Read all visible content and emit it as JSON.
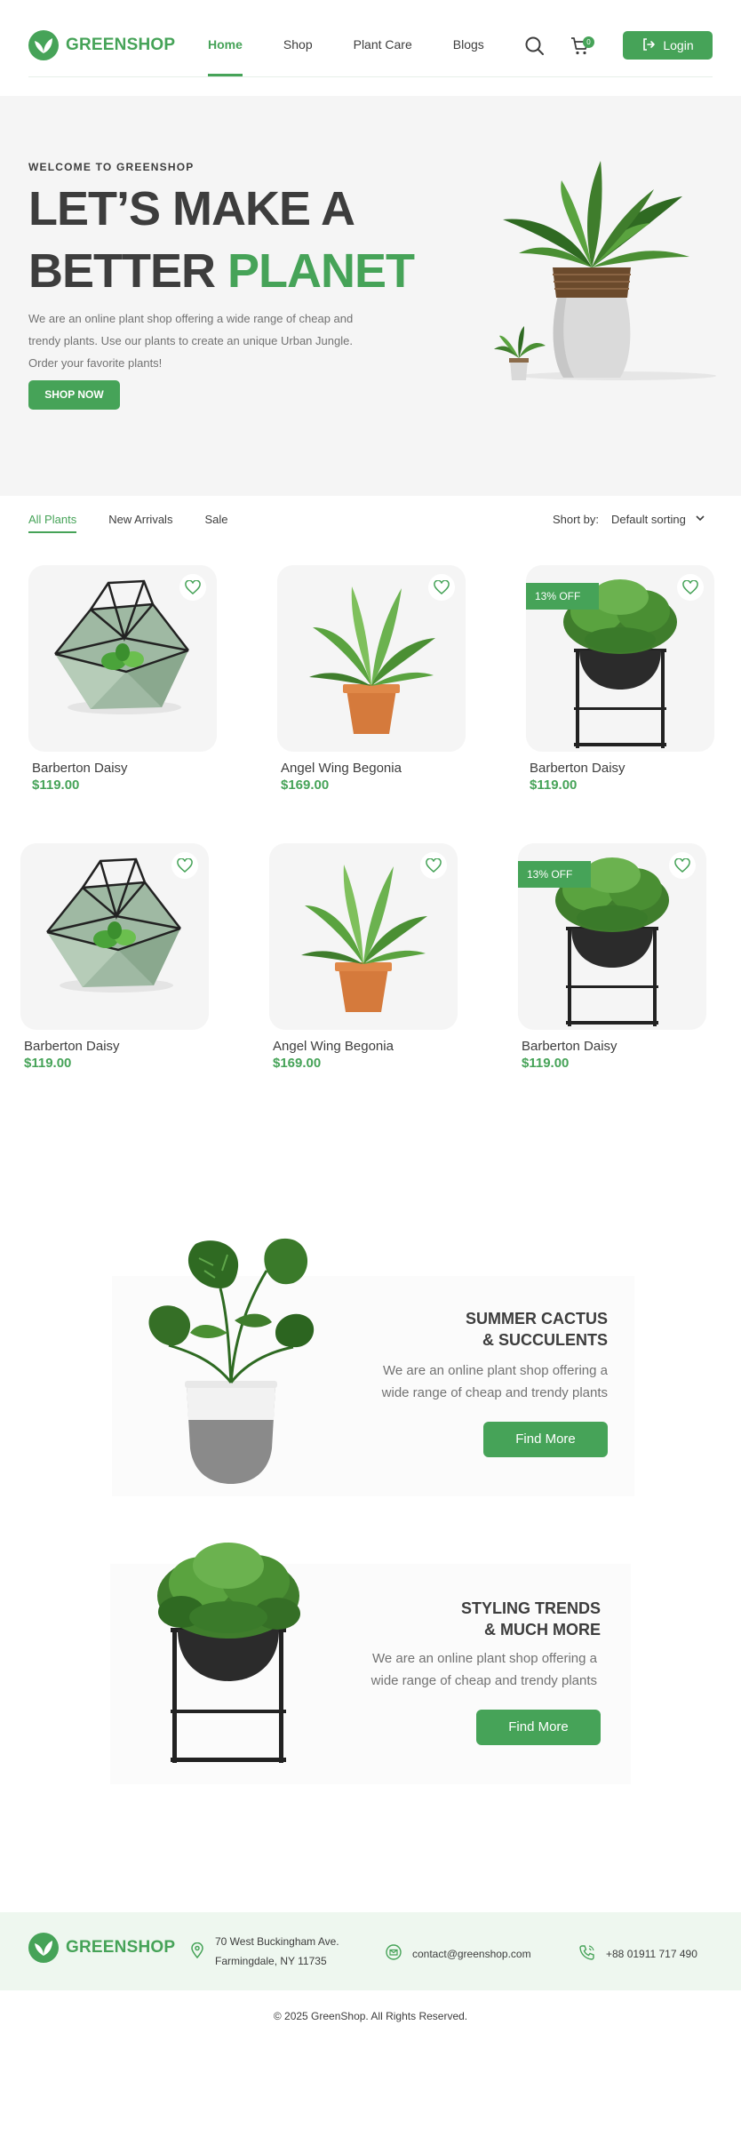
{
  "brand": {
    "name": "GREENSHOP",
    "accent": "#46a358",
    "text": "#3d3d3d"
  },
  "header": {
    "nav": [
      {
        "label": "Home",
        "active": true
      },
      {
        "label": "Shop",
        "active": false
      },
      {
        "label": "Plant Care",
        "active": false
      },
      {
        "label": "Blogs",
        "active": false
      }
    ],
    "cart_count": "0",
    "login_label": "Login",
    "icons": [
      "search-icon",
      "cart-icon",
      "logout-icon"
    ]
  },
  "hero": {
    "welcome": "WELCOME TO GREENSHOP",
    "title_line1": "LET’S MAKE A",
    "title_line2_prefix": "BETTER ",
    "title_line2_accent": "PLANET",
    "description": "We are an online plant shop offering a wide range of cheap and trendy plants. Use our plants to create an unique Urban Jungle. Order your favorite plants!",
    "cta": "SHOP NOW"
  },
  "filters": {
    "tabs": [
      {
        "label": "All Plants",
        "active": true
      },
      {
        "label": "New Arrivals",
        "active": false
      },
      {
        "label": "Sale",
        "active": false
      }
    ],
    "sort_label": "Short by:",
    "sort_value": "Default sorting"
  },
  "products": [
    {
      "name": "Barberton Daisy",
      "price": "$119.00",
      "image": "geometric-terrarium",
      "sale": ""
    },
    {
      "name": "Angel Wing Begonia",
      "price": "$169.00",
      "image": "fern-orange-pot",
      "sale": ""
    },
    {
      "name": "Barberton Daisy",
      "price": "$119.00",
      "image": "bush-black-stand",
      "sale": "13% OFF"
    },
    {
      "name": "Barberton Daisy",
      "price": "$119.00",
      "image": "geometric-terrarium",
      "sale": ""
    },
    {
      "name": "Angel Wing Begonia",
      "price": "$169.00",
      "image": "fern-orange-pot",
      "sale": ""
    },
    {
      "name": "Barberton Daisy",
      "price": "$119.00",
      "image": "bush-black-stand",
      "sale": "13% OFF"
    }
  ],
  "banners": [
    {
      "title_line1": "SUMMER CACTUS",
      "title_line2": "& SUCCULENTS",
      "desc_line1": "We are an online plant shop offering a",
      "desc_line2": "wide range of cheap and trendy plants",
      "button": "Find More"
    },
    {
      "title_line1": "STYLING TRENDS",
      "title_line2": "& MUCH MORE",
      "desc_line1": "We are an online plant shop offering a",
      "desc_line2": "wide range of cheap and trendy plants",
      "button": "Find More"
    }
  ],
  "footer": {
    "address_line1": "70 West Buckingham Ave.",
    "address_line2": "Farmingdale, NY 11735",
    "email": "contact@greenshop.com",
    "phone": "+88 01911 717 490",
    "copyright": "© 2025 GreenShop. All Rights Reserved."
  }
}
